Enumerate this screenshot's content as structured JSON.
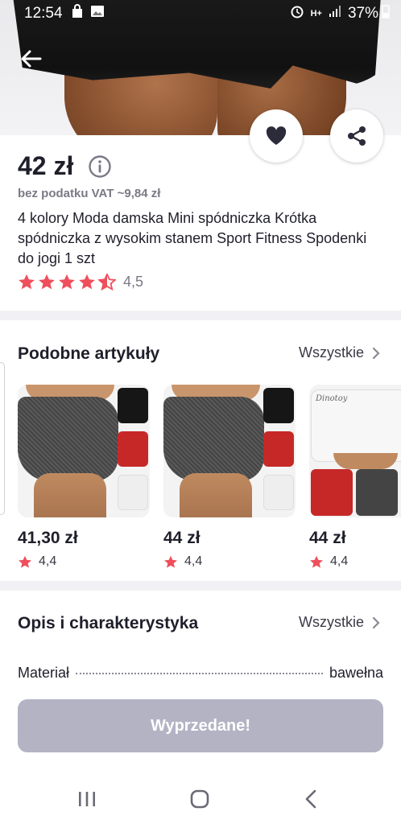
{
  "status_bar": {
    "time": "12:54",
    "network": "H+",
    "battery": "37%"
  },
  "product": {
    "price": "42 zł",
    "vat_note": "bez podatku VAT ~9,84 zł",
    "title": "4 kolory Moda damska Mini spódniczka Krótka spódniczka z wysokim stanem Sport Fitness Spodenki do jogi 1 szt",
    "rating": "4,5",
    "rating_value": 4.5,
    "star_color": "#ef4f5c"
  },
  "similar": {
    "title": "Podobne artykuły",
    "see_all": "Wszystkie",
    "items": [
      {
        "price": "41,30 zł",
        "rating": "4,4"
      },
      {
        "price": "44 zł",
        "rating": "4,4"
      },
      {
        "price": "44 zł",
        "rating": "4,4",
        "logo": "Dinotoy"
      }
    ]
  },
  "description": {
    "title": "Opis i charakterystyka",
    "see_all": "Wszystkie",
    "spec_label": "Materiał",
    "spec_value": "bawełna"
  },
  "action": {
    "sold_out_label": "Wyprzedane!",
    "button_color": "#b3b3c4"
  },
  "icons": [
    "back-arrow-icon",
    "heart-icon",
    "share-icon",
    "info-icon",
    "star-icon",
    "chevron-right-icon",
    "recent-apps-icon",
    "home-icon",
    "nav-back-icon"
  ]
}
